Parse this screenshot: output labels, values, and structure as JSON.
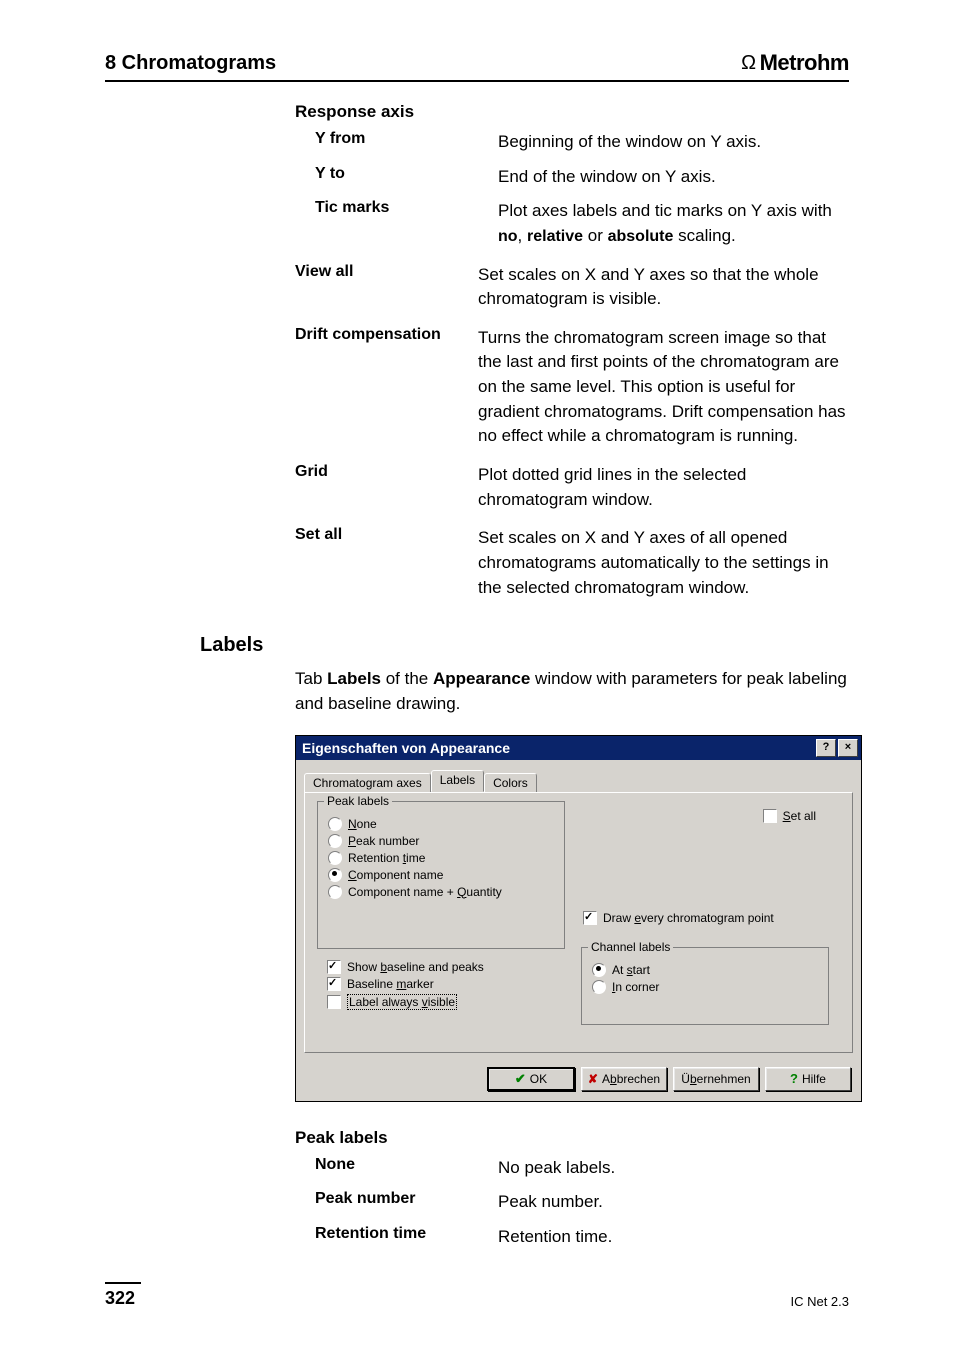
{
  "header": {
    "chapter": "8 Chromatograms",
    "brand": "Metrohm"
  },
  "defs": {
    "response_axis_title": "Response axis",
    "y_from": {
      "term": "Y from",
      "desc": "Beginning of the window on Y axis."
    },
    "y_to": {
      "term": "Y to",
      "desc": "End of the window on Y axis."
    },
    "tic_marks": {
      "term": "Tic marks",
      "desc_pre": "Plot axes labels and tic marks on Y axis with ",
      "b1": "no",
      "sep1": ", ",
      "b2": "relative",
      "sep2": " or ",
      "b3": "absolute",
      "desc_post": " scaling."
    },
    "view_all": {
      "term": "View all",
      "desc": "Set scales on X and Y axes so that the whole chromatogram is visible."
    },
    "drift": {
      "term": "Drift compensation",
      "desc": "Turns the chromatogram screen image so that the last and first points of the chromatogram are on the same level. This option is useful for gradient chromatograms. Drift compensation has no effect while a chromatogram is running."
    },
    "grid": {
      "term": "Grid",
      "desc": "Plot dotted grid lines in the selected chromatogram window."
    },
    "set_all": {
      "term": "Set all",
      "desc": "Set scales on X and Y axes of all opened chromatograms automatically to the settings in the selected chromatogram window."
    }
  },
  "labels_section": {
    "heading": "Labels",
    "para_pre": "Tab ",
    "b1": "Labels",
    "para_mid": " of the ",
    "b2": "Appearance",
    "para_post": " window with parameters for peak labeling and baseline drawing."
  },
  "dialog": {
    "title": "Eigenschaften von Appearance",
    "tabs": {
      "chrom_axes": "Chromatogram axes",
      "labels": "Labels",
      "colors": "Colors"
    },
    "groups": {
      "peak_labels": "Peak labels",
      "channel_labels": "Channel labels"
    },
    "radios": {
      "none": {
        "u": "N",
        "rest": "one"
      },
      "peak_number": {
        "u": "P",
        "rest": "eak number"
      },
      "retention_time": {
        "pre": "Retention ",
        "u": "t",
        "rest": "ime"
      },
      "component_name": {
        "u": "C",
        "rest": "omponent name"
      },
      "component_name_qty": {
        "pre": "Component name + ",
        "u": "Q",
        "rest": "uantity"
      },
      "at_start": {
        "pre": "At ",
        "u": "s",
        "rest": "tart"
      },
      "in_corner": {
        "u": "I",
        "rest": "n corner"
      }
    },
    "checks": {
      "set_all": {
        "u": "S",
        "rest": "et all"
      },
      "draw_every": {
        "pre": "Draw ",
        "u": "e",
        "rest": "very chromatogram point"
      },
      "show_baseline": {
        "pre": "Show ",
        "u": "b",
        "rest": "aseline and peaks"
      },
      "baseline_marker": {
        "pre": "Baseline ",
        "u": "m",
        "rest": "arker"
      },
      "label_always": {
        "pre": "Label always ",
        "u": "v",
        "rest": "isible"
      }
    },
    "buttons": {
      "ok": "OK",
      "cancel": {
        "pre": "A",
        "u": "b",
        "rest": "brechen"
      },
      "apply": {
        "pre": "Ü",
        "u": "b",
        "rest": "ernehmen"
      },
      "help": "Hilfe"
    }
  },
  "peak_defs": {
    "title": "Peak labels",
    "none": {
      "term": "None",
      "desc": "No peak labels."
    },
    "peak_number": {
      "term": "Peak number",
      "desc": "Peak number."
    },
    "retention_time": {
      "term": "Retention time",
      "desc": "Retention time."
    }
  },
  "footer": {
    "page": "322",
    "product": "IC Net 2.3"
  }
}
